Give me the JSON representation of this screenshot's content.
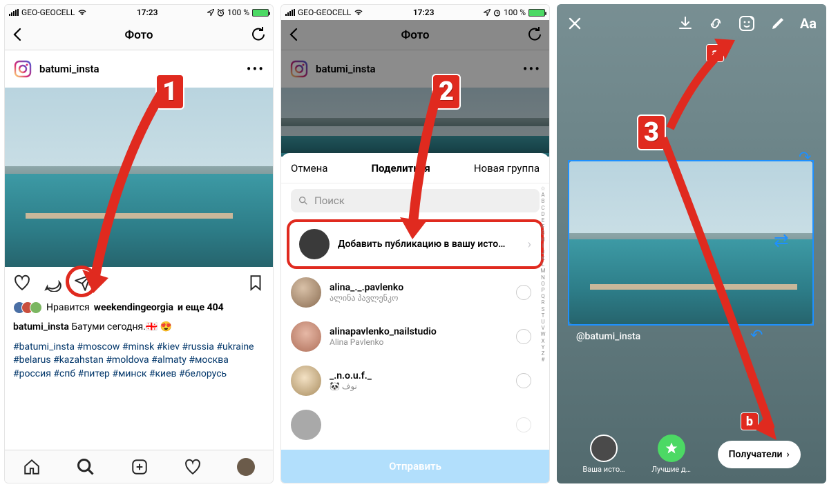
{
  "statusbar": {
    "carrier": "GEO-GEOCELL",
    "time": "17:23",
    "battery": "100 %"
  },
  "screen1": {
    "header_title": "Фото",
    "username": "batumi_insta",
    "likes_prefix": "Нравится",
    "likes_user": "weekendingeorgia",
    "likes_suffix": "и еще 404",
    "caption_user": "batumi_insta",
    "caption_text": "Батуми сегодня.🇬🇪 😍",
    "hashtags": "#batumi_insta #moscow #minsk #kiev #russia #ukraine #belarus #kazahstan #moldova #almaty #москва #россия #спб #питер #минск #киев #белорусь"
  },
  "screen2": {
    "header_title": "Фото",
    "cancel": "Отмена",
    "share": "Поделиться",
    "new_group": "Новая группа",
    "search_placeholder": "Поиск",
    "add_to_story": "Добавить публикацию в вашу исто…",
    "contacts": [
      {
        "name": "alina_._.pavlenko",
        "sub": "ალინა პავლენკო"
      },
      {
        "name": "alinapavlenko_nailstudio",
        "sub": "Alina Pavlenko"
      },
      {
        "name": "_.n.o.u.f._",
        "sub": "🐼 نوف"
      }
    ],
    "send": "Отправить",
    "az_index": "☆ A B C D E F G H I J K L M N O P Q R S T U V W X Y Z #"
  },
  "screen3": {
    "mention": "@batumi_insta",
    "your_story": "Ваша исто…",
    "best_friends": "Лучшие д…",
    "recipients": "Получатели",
    "text_tool": "Aa"
  },
  "annotations": {
    "n1": "1",
    "n2": "2",
    "n3": "3",
    "a": "a",
    "b": "b"
  }
}
